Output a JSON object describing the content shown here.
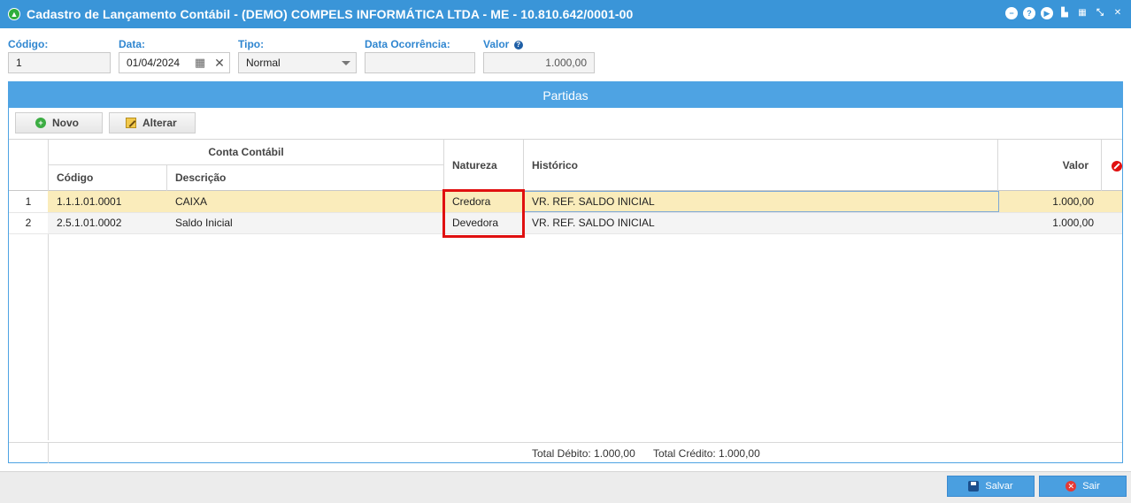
{
  "window": {
    "title": "Cadastro de Lançamento Contábil - (DEMO) COMPELS INFORMÁTICA LTDA - ME - 10.810.642/0001-00",
    "controls": [
      "minimize-icon",
      "help-icon",
      "play-icon",
      "print-icon",
      "calendar-icon",
      "collapse-icon",
      "close-icon"
    ]
  },
  "form": {
    "codigo": {
      "label": "Código:",
      "value": "1"
    },
    "data": {
      "label": "Data:",
      "value": "01/04/2024"
    },
    "tipo": {
      "label": "Tipo:",
      "value": "Normal"
    },
    "data_ocorrencia": {
      "label": "Data Ocorrência:",
      "value": ""
    },
    "valor": {
      "label": "Valor",
      "help": "?",
      "value": "1.000,00"
    }
  },
  "partidas": {
    "title": "Partidas",
    "buttons": {
      "novo": "Novo",
      "alterar": "Alterar"
    },
    "columns": {
      "conta_contabil": "Conta Contábil",
      "codigo": "Código",
      "descricao": "Descrição",
      "natureza": "Natureza",
      "historico": "Histórico",
      "valor": "Valor"
    },
    "rows": [
      {
        "num": "1",
        "codigo": "1.1.1.01.0001",
        "descricao": "CAIXA",
        "natureza": "Credora",
        "historico": "VR. REF. SALDO INICIAL",
        "valor": "1.000,00"
      },
      {
        "num": "2",
        "codigo": "2.5.1.01.0002",
        "descricao": "Saldo Inicial",
        "natureza": "Devedora",
        "historico": "VR. REF. SALDO INICIAL",
        "valor": "1.000,00"
      }
    ],
    "totals": {
      "debito": "Total Débito: 1.000,00",
      "credito": "Total Crédito: 1.000,00"
    }
  },
  "actions": {
    "salvar": "Salvar",
    "sair": "Sair"
  },
  "colors": {
    "titlebar": "#3a95d8",
    "panel_header": "#4ea3e3",
    "selected_row": "#faecbb",
    "highlight": "#e01010",
    "label": "#2f86d0"
  }
}
